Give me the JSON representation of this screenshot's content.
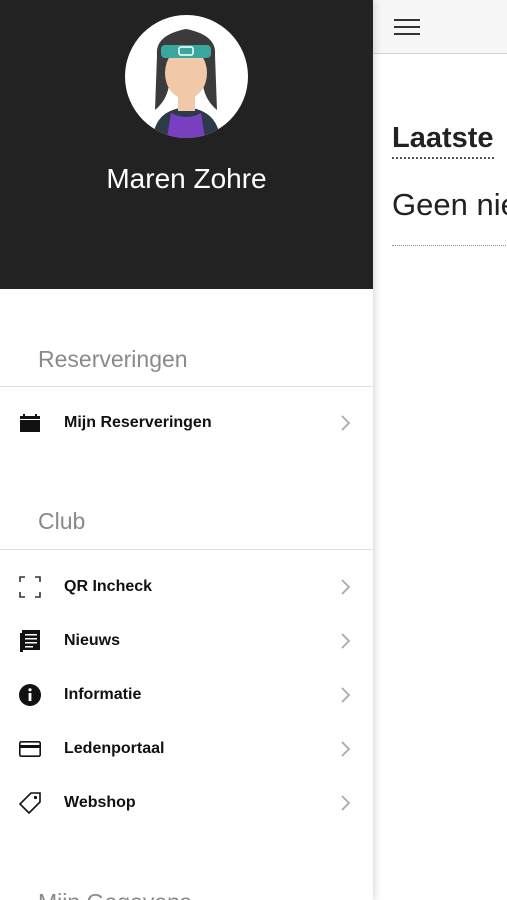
{
  "profile": {
    "name": "Maren Zohre"
  },
  "main": {
    "title": "Laatste",
    "empty_text": "Geen nie"
  },
  "sections": [
    {
      "header": "Reserveringen",
      "items": [
        {
          "label": "Mijn Reserveringen",
          "icon": "calendar-icon"
        }
      ]
    },
    {
      "header": "Club",
      "items": [
        {
          "label": "QR Incheck",
          "icon": "qr-scan-icon"
        },
        {
          "label": "Nieuws",
          "icon": "news-icon"
        },
        {
          "label": "Informatie",
          "icon": "info-icon"
        },
        {
          "label": "Ledenportaal",
          "icon": "card-icon"
        },
        {
          "label": "Webshop",
          "icon": "tag-icon"
        }
      ]
    },
    {
      "header": "Mijn Gegevens",
      "items": []
    }
  ],
  "colors": {
    "drawer_header_bg": "#222222",
    "section_header_text": "#8a8a8a"
  }
}
